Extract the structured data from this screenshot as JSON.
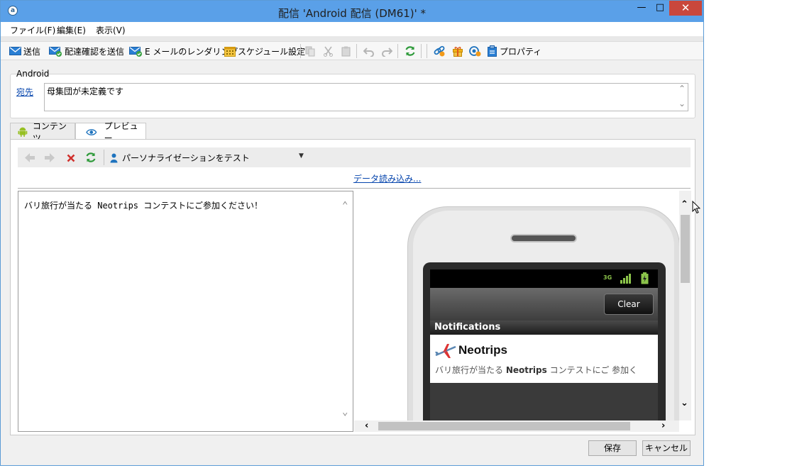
{
  "window": {
    "title": "配信 'Android 配信 (DM61)' *",
    "app_icon_glyph": "a",
    "minimize_glyph": "—",
    "maximize_glyph": "□",
    "close_glyph": "✕"
  },
  "menu": [
    "ファイル(F)",
    "編集(E)",
    "表示(V)"
  ],
  "toolbar": {
    "send": "送信",
    "send_proof": "配達確認を送信",
    "email_render": "E メールのレンダリング",
    "schedule": "スケジュール設定",
    "properties": "プロパティ"
  },
  "group": {
    "label": "Android",
    "recipient_link": "宛先",
    "recipient_value": "母集団が未定義です"
  },
  "tabs": [
    "コンテンツ",
    "プレビュー"
  ],
  "active_tab": "プレビュー",
  "preview": {
    "personalization_label": "パーソナライゼーションをテスト",
    "data_load_link": "データ読み込み...",
    "message_text": "バリ旅行が当たる Neotrips コンテストにご参加ください！"
  },
  "phone": {
    "network": "3G",
    "clear_button": "Clear",
    "notifications_header": "Notifications",
    "app_name": "Neotrips",
    "notification_text_before": "バリ旅行が当たる ",
    "notification_text_bold": "Neotrips",
    "notification_text_after": " コンテストにご 参加く"
  },
  "footer": {
    "save": "保存",
    "cancel": "キャンセル"
  },
  "colors": {
    "titlebar": "#5aa0e8",
    "close": "#c9473c",
    "link": "#0645ad",
    "toolbar_icon_blue": "#1e73be",
    "refresh_green": "#2e9a3a"
  }
}
